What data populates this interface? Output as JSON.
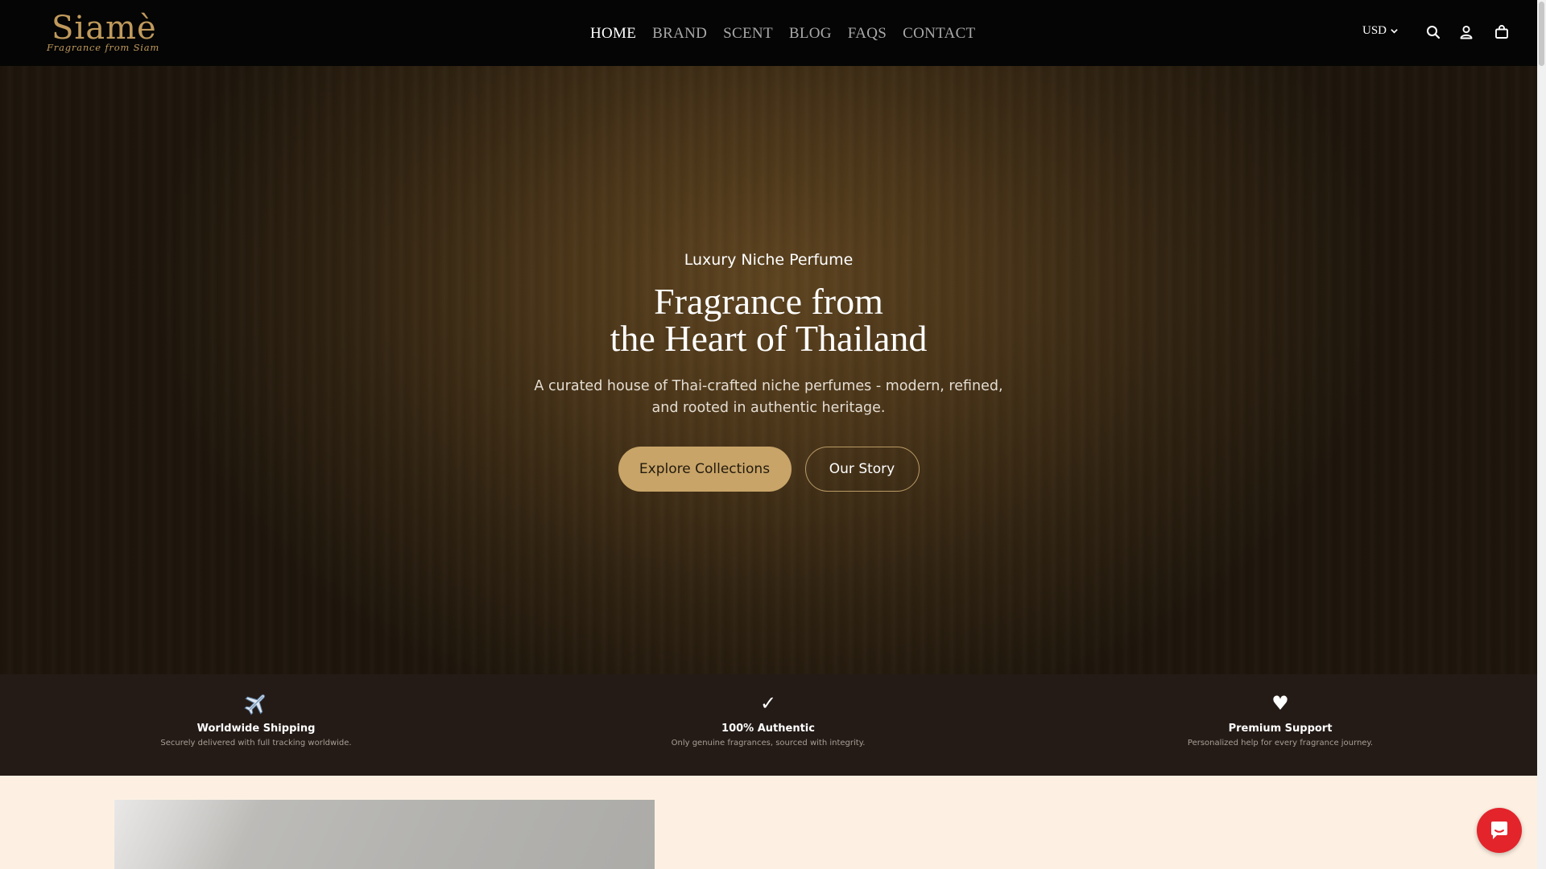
{
  "header": {
    "logo": {
      "wordmark": "Siamè",
      "tagline": "Fragrance from Siam"
    },
    "nav": [
      {
        "label": "HOME",
        "active": true
      },
      {
        "label": "BRAND",
        "active": false
      },
      {
        "label": "SCENT",
        "active": false
      },
      {
        "label": "BLOG",
        "active": false
      },
      {
        "label": "FAQS",
        "active": false
      },
      {
        "label": "CONTACT",
        "active": false
      }
    ],
    "currency": "USD",
    "icons": [
      "search-icon",
      "account-icon",
      "cart-icon"
    ]
  },
  "hero": {
    "kicker": "Luxury Niche Perfume",
    "title_line1": "Fragrance from",
    "title_line2": "the Heart of Thailand",
    "subtitle_line1": "A curated house of Thai-crafted niche perfumes - modern, refined,",
    "subtitle_line2": "and rooted in authentic heritage.",
    "primary_button": "Explore Collections",
    "secondary_button": "Our Story"
  },
  "features": [
    {
      "icon": "airplane-icon",
      "glyph": "✈️",
      "title": "Worldwide Shipping",
      "desc": "Securely delivered with full tracking worldwide."
    },
    {
      "icon": "checkmark-icon",
      "glyph": "✓",
      "title": "100% Authentic",
      "desc": "Only genuine fragrances, sourced with integrity."
    },
    {
      "icon": "heart-icon",
      "glyph": "♥",
      "title": "Premium Support",
      "desc": "Personalized help for every fragrance journey."
    }
  ],
  "colors": {
    "header_bg": "#050505",
    "accent_gold": "#c8a468",
    "features_bg": "#241b17",
    "page_bg": "#fdf0e2",
    "chat_red": "#e3242b"
  }
}
